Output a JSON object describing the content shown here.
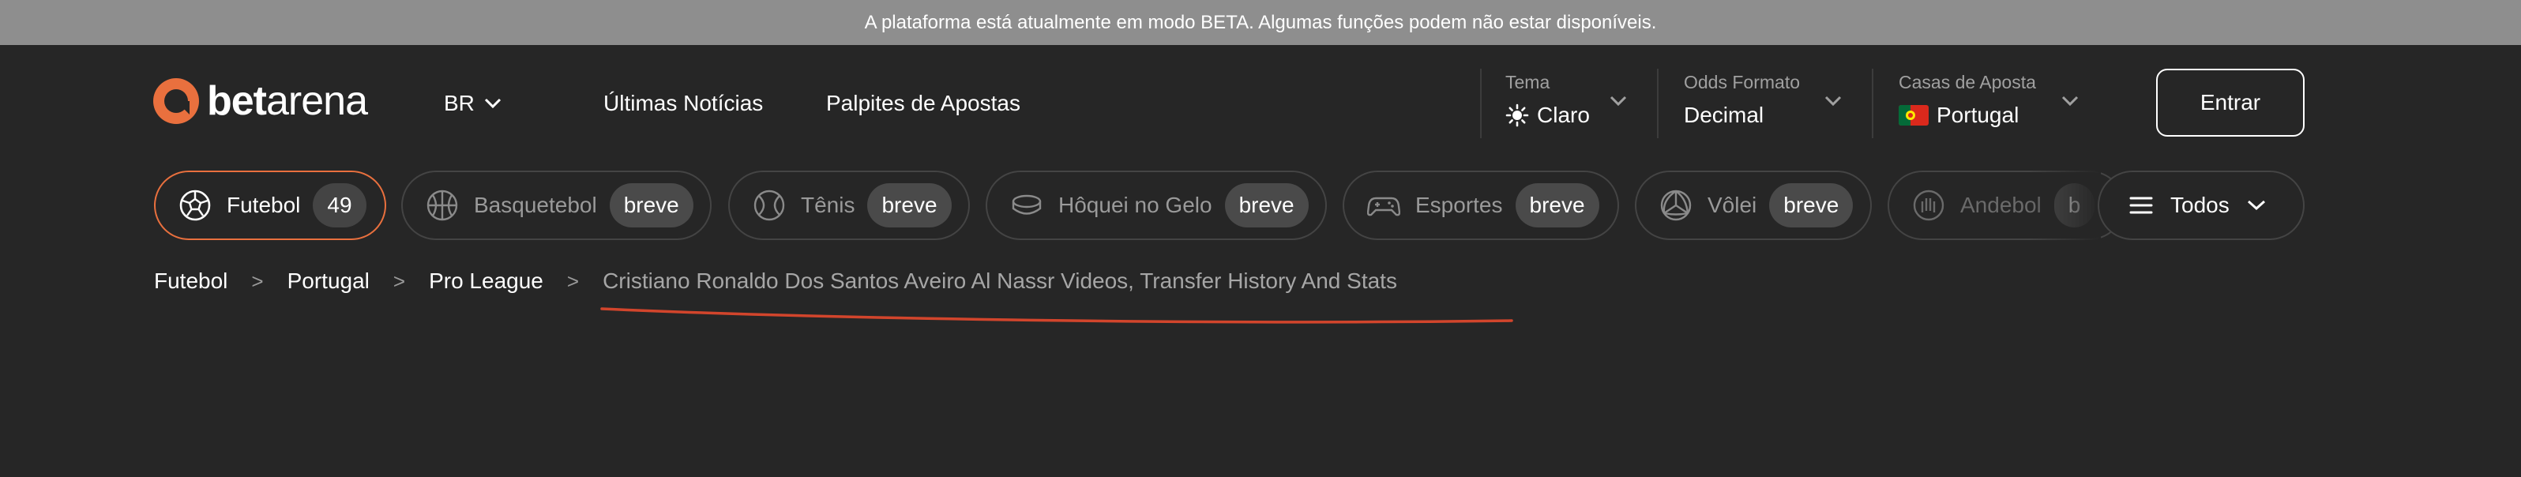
{
  "banner": {
    "text": "A plataforma está atualmente em modo BETA. Algumas funções podem não estar disponíveis."
  },
  "brand": {
    "part1": "bet",
    "part2": "arena",
    "accent_color": "#e9703e"
  },
  "language": {
    "label": "BR",
    "icon": "chevron-down-icon"
  },
  "nav": {
    "latest_news": "Últimas Notícias",
    "betting_tips": "Palpites de Apostas"
  },
  "settings": {
    "theme": {
      "label": "Tema",
      "value": "Claro",
      "icon": "sun-icon"
    },
    "odds": {
      "label": "Odds Formato",
      "value": "Decimal"
    },
    "bookmakers": {
      "label": "Casas de Aposta",
      "value": "Portugal",
      "icon": "portugal-flag-icon"
    }
  },
  "login": {
    "label": "Entrar"
  },
  "sports": [
    {
      "name": "Futebol",
      "badge": "49",
      "icon": "soccer-ball-icon",
      "active": true
    },
    {
      "name": "Basquetebol",
      "badge": "breve",
      "icon": "basketball-icon",
      "active": false
    },
    {
      "name": "Tênis",
      "badge": "breve",
      "icon": "tennis-ball-icon",
      "active": false
    },
    {
      "name": "Hôquei no Gelo",
      "badge": "breve",
      "icon": "hockey-puck-icon",
      "active": false
    },
    {
      "name": "Esportes",
      "badge": "breve",
      "icon": "gamepad-icon",
      "active": false
    },
    {
      "name": "Vôlei",
      "badge": "breve",
      "icon": "volleyball-icon",
      "active": false
    },
    {
      "name": "Andebol",
      "badge": "b",
      "icon": "handball-icon",
      "active": false
    }
  ],
  "all_sports": {
    "label": "Todos",
    "icon": "menu-icon"
  },
  "breadcrumb": {
    "items": [
      "Futebol",
      "Portugal",
      "Pro League"
    ],
    "current": "Cristiano Ronaldo Dos Santos Aveiro Al Nassr Videos, Transfer History And Stats",
    "separator": ">"
  },
  "annotation": {
    "color": "#d2452c"
  }
}
